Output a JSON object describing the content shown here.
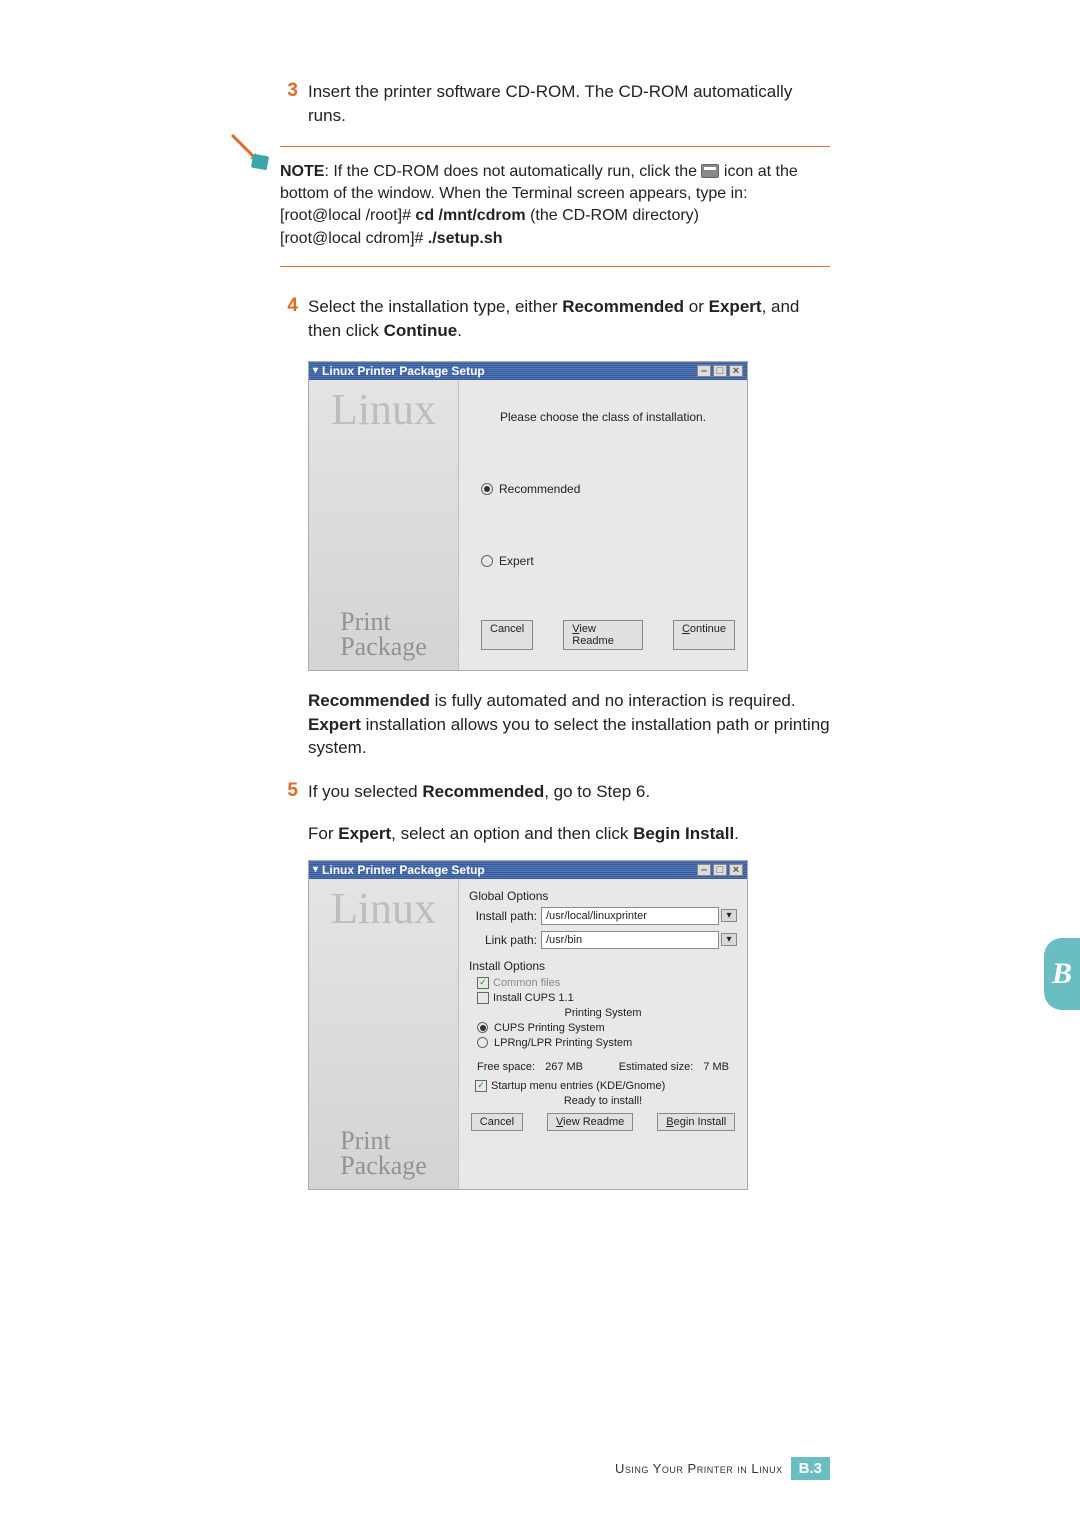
{
  "steps": {
    "s3": {
      "num": "3",
      "text_a": "Insert the printer software CD-ROM. The CD-ROM automatically runs."
    },
    "s4": {
      "num": "4",
      "text_a": "Select the installation type, either ",
      "b1": "Recommended",
      "mid": " or ",
      "b2": "Expert",
      "mid2": ", and then click ",
      "b3": "Continue",
      "end": "."
    },
    "s5": {
      "num": "5",
      "text_a": "If you selected ",
      "b1": "Recommended",
      "mid": ", go to Step 6."
    }
  },
  "note": {
    "label": "NOTE",
    "sep": ": ",
    "body1": "If the CD-ROM does not automatically run, click the ",
    "body2": " icon at the bottom of the window. When the Terminal screen appears, type in:",
    "cmd1_prefix": "[root@local /root]# ",
    "cmd1_bold": "cd /mnt/cdrom",
    "cmd1_suffix": " (the CD-ROM directory)",
    "cmd2_prefix": "[root@local cdrom]# ",
    "cmd2_bold": "./setup.sh"
  },
  "para_rec": {
    "b1": "Recommended",
    "t1": " is fully automated and no interaction is required. ",
    "b2": "Expert",
    "t2": " installation allows you to select the installation path or printing system."
  },
  "para_expert": {
    "t1": "For ",
    "b1": "Expert",
    "t2": ", select an option and then click ",
    "b2": "Begin Install",
    "t3": "."
  },
  "dialog": {
    "title": "Linux Printer Package Setup",
    "left_brand_top": "Linux",
    "left_brand_bottom1": "Print",
    "left_brand_bottom2": "Package",
    "prompt": "Please choose the class of installation.",
    "opt_recommended": "Recommended",
    "opt_expert": "Expert",
    "btn_cancel": "Cancel",
    "btn_view_u": "V",
    "btn_view_rest": "iew Readme",
    "btn_cont_u": "C",
    "btn_cont_rest": "ontinue"
  },
  "dialog2": {
    "title": "Linux Printer Package Setup",
    "global_options": "Global Options",
    "install_path_label": "Install path:",
    "install_path_value": "/usr/local/linuxprinter",
    "link_path_label": "Link path:",
    "link_path_value": "/usr/bin",
    "install_options": "Install Options",
    "common_files": "Common files",
    "install_cups": "Install CUPS 1.1",
    "printing_system": "Printing System",
    "cups_system": "CUPS Printing System",
    "lprng_system": "LPRng/LPR Printing System",
    "free_space_label": "Free space:",
    "free_space_value": "267 MB",
    "est_size_label": "Estimated size:",
    "est_size_value": "7 MB",
    "startup_entries": "Startup menu entries (KDE/Gnome)",
    "ready": "Ready to install!",
    "btn_cancel": "Cancel",
    "btn_view_u": "V",
    "btn_view_rest": "iew Readme",
    "btn_begin_u": "B",
    "btn_begin_rest": "egin Install"
  },
  "sidetab": "B",
  "footer": {
    "text": "Using Your Printer in Linux",
    "page_prefix": "B.",
    "page_num": "3"
  }
}
